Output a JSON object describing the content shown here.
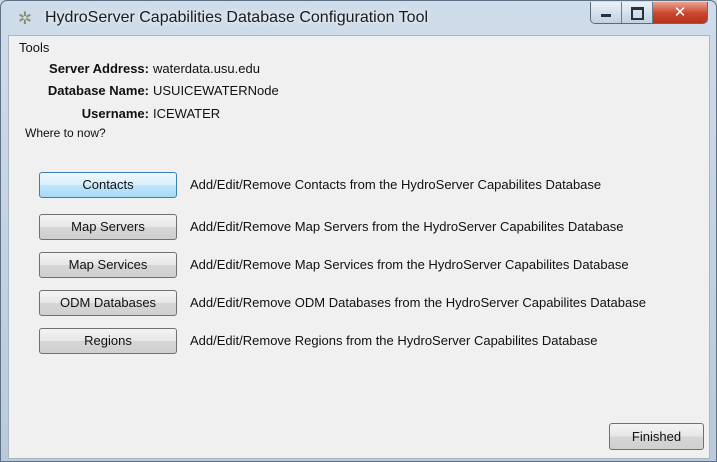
{
  "window": {
    "title": "HydroServer Capabilities Database Configuration Tool",
    "icon": "app-gear-icon"
  },
  "controls": {
    "minimize_icon": "minimize-icon",
    "maximize_icon": "maximize-icon",
    "close_symbol": "✕"
  },
  "menu": {
    "tools": "Tools"
  },
  "info": {
    "server_address_label": "Server Address:",
    "server_address_value": "waterdata.usu.edu",
    "database_name_label": "Database Name:",
    "database_name_value": "USUICEWATERNode",
    "username_label": "Username:",
    "username_value": "ICEWATER"
  },
  "where_to_now": "Where to now?",
  "actions": [
    {
      "label": "Contacts",
      "description": "Add/Edit/Remove Contacts from the HydroServer Capabilites Database"
    },
    {
      "label": "Map Servers",
      "description": "Add/Edit/Remove Map Servers from the HydroServer Capabilites Database"
    },
    {
      "label": "Map Services",
      "description": "Add/Edit/Remove Map Services from the HydroServer Capabilites Database"
    },
    {
      "label": "ODM Databases",
      "description": "Add/Edit/Remove ODM Databases from the HydroServer Capabilites Database"
    },
    {
      "label": "Regions",
      "description": "Add/Edit/Remove Regions from the HydroServer Capabilites Database"
    }
  ],
  "finished_label": "Finished",
  "colors": {
    "focus_border": "#3c7fb1",
    "close_button": "#c9452b",
    "client_bg": "#f0f0f0"
  }
}
